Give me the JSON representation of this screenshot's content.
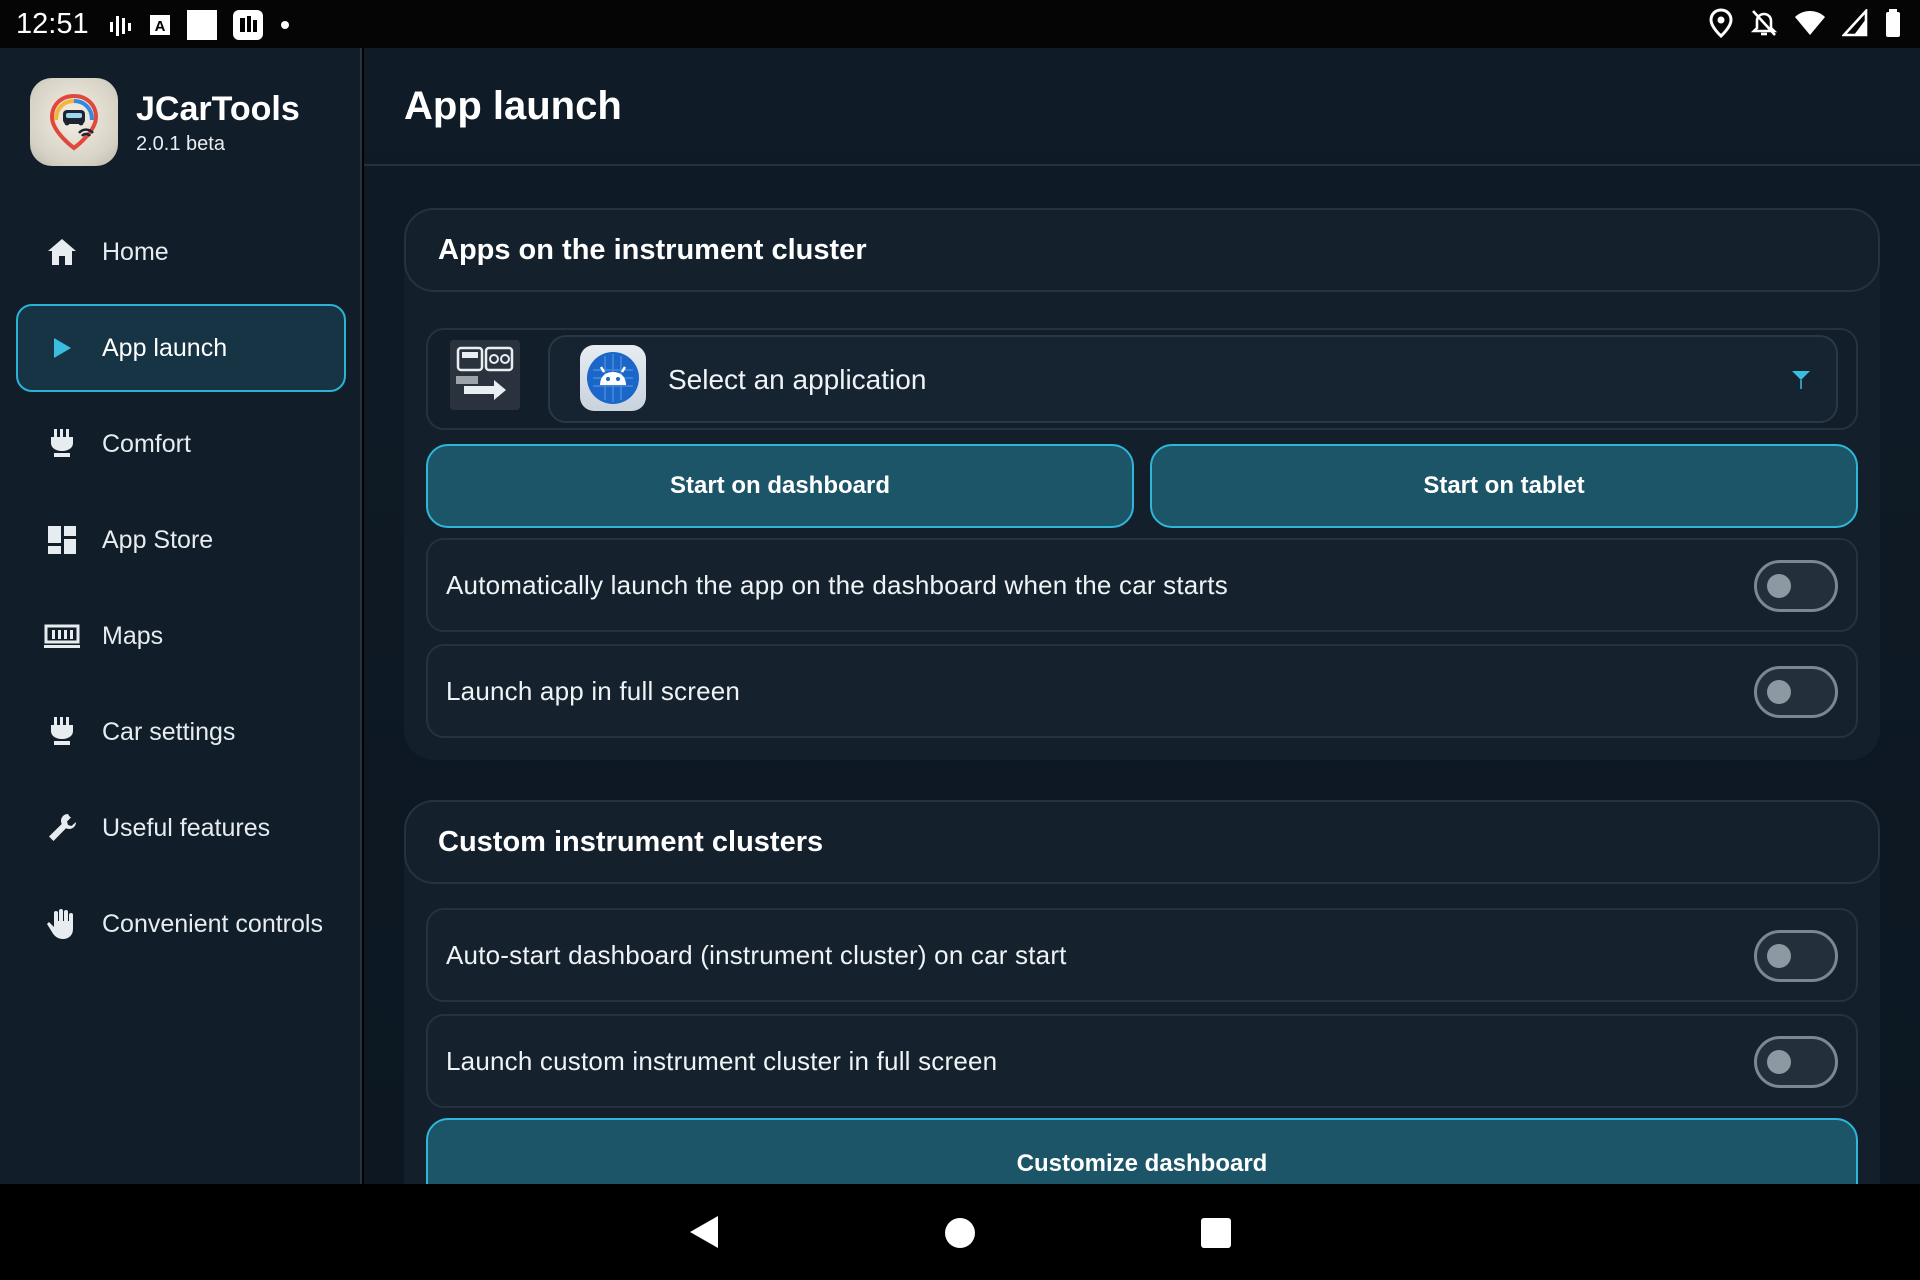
{
  "status_bar": {
    "time": "12:51",
    "left_icons": [
      "signal-bars-icon",
      "font-a-icon",
      "white-square-icon",
      "news-app-icon",
      "dot-icon"
    ],
    "right_icons": [
      "location-icon",
      "bell-off-icon",
      "wifi-icon",
      "cell-signal-icon",
      "battery-icon"
    ]
  },
  "app": {
    "name": "JCarTools",
    "version": "2.0.1 beta"
  },
  "sidebar": {
    "items": [
      {
        "label": "Home",
        "icon": "home-icon",
        "active": false
      },
      {
        "label": "App launch",
        "icon": "play-icon",
        "active": true
      },
      {
        "label": "Comfort",
        "icon": "seat-icon",
        "active": false
      },
      {
        "label": "App Store",
        "icon": "dashboard-grid-icon",
        "active": false
      },
      {
        "label": "Maps",
        "icon": "map-icon",
        "active": false
      },
      {
        "label": "Car settings",
        "icon": "seat-icon",
        "active": false
      },
      {
        "label": "Useful features",
        "icon": "wrench-icon",
        "active": false
      },
      {
        "label": "Convenient controls",
        "icon": "hand-icon",
        "active": false
      }
    ]
  },
  "main": {
    "title": "App launch",
    "section_cluster": {
      "title": "Apps on the instrument cluster",
      "app_selector": {
        "value": "Select an application"
      },
      "btn_dashboard": "Start on dashboard",
      "btn_tablet": "Start on tablet",
      "toggles": [
        {
          "label": "Automatically launch the app on the dashboard when the car starts",
          "on": false
        },
        {
          "label": "Launch app in full screen",
          "on": false
        }
      ]
    },
    "section_custom": {
      "title": "Custom instrument clusters",
      "toggles": [
        {
          "label": "Auto-start dashboard (instrument cluster) on car start",
          "on": false
        },
        {
          "label": "Launch custom instrument cluster in full screen",
          "on": false
        }
      ],
      "btn_customize": "Customize dashboard"
    }
  },
  "colors": {
    "accent": "#2bb3d6",
    "button_fill": "#1c5468",
    "background": "#0f1b26",
    "sidebar": "#111d29"
  }
}
